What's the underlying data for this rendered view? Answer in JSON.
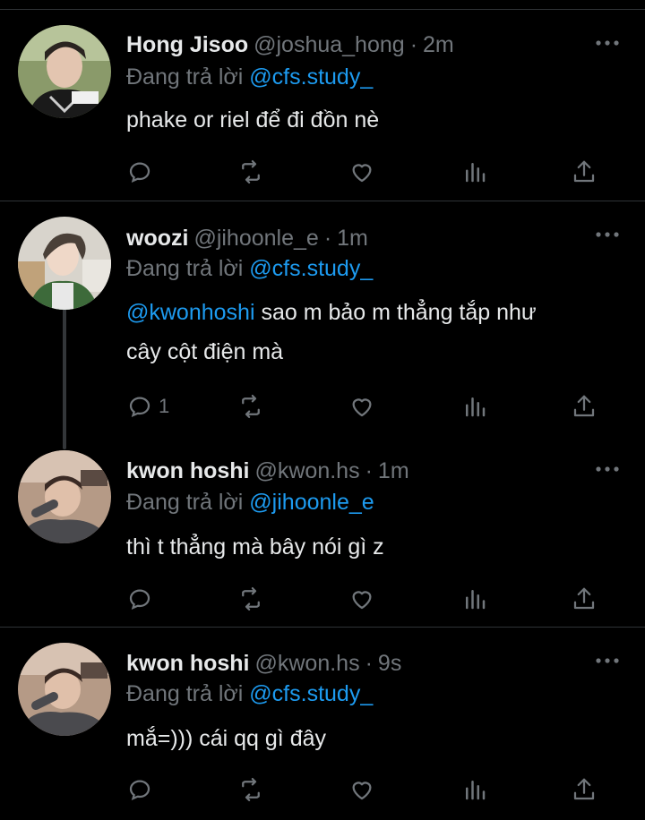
{
  "colors": {
    "background": "#000000",
    "text": "#e7e9ea",
    "muted": "#71767b",
    "link": "#1d9bf0",
    "separator": "#2f3336"
  },
  "tweets": [
    {
      "display_name": "Hong Jisoo",
      "handle": "@joshua_hong",
      "time": "2m",
      "reply_prefix": "Đang trả lời",
      "reply_to": "@cfs.study_",
      "mention": "",
      "text": "phake or riel để đi đồn nè",
      "text_line2": "",
      "reply_count": "",
      "avatar_icon": "avatar-photo"
    },
    {
      "display_name": "woozi",
      "handle": "@jihoonle_e",
      "time": "1m",
      "reply_prefix": "Đang trả lời",
      "reply_to": "@cfs.study_",
      "mention": "@kwonhoshi",
      "text": " sao m bảo m thẳng tắp như",
      "text_line2": "cây cột điện mà",
      "reply_count": "1",
      "avatar_icon": "avatar-photo"
    },
    {
      "display_name": "kwon hoshi",
      "handle": "@kwon.hs",
      "time": "1m",
      "reply_prefix": "Đang trả lời",
      "reply_to": "@jihoonle_e",
      "mention": "",
      "text": "thì t thẳng mà bây nói gì z",
      "text_line2": "",
      "reply_count": "",
      "avatar_icon": "avatar-photo"
    },
    {
      "display_name": "kwon hoshi",
      "handle": "@kwon.hs",
      "time": "9s",
      "reply_prefix": "Đang trả lời",
      "reply_to": "@cfs.study_",
      "mention": "",
      "text": "mắ=))) cái qq gì đây",
      "text_line2": "",
      "reply_count": "",
      "avatar_icon": "avatar-photo"
    }
  ],
  "dot_separator": "·",
  "action_icons": [
    "reply-icon",
    "retweet-icon",
    "like-icon",
    "views-icon",
    "share-icon"
  ]
}
